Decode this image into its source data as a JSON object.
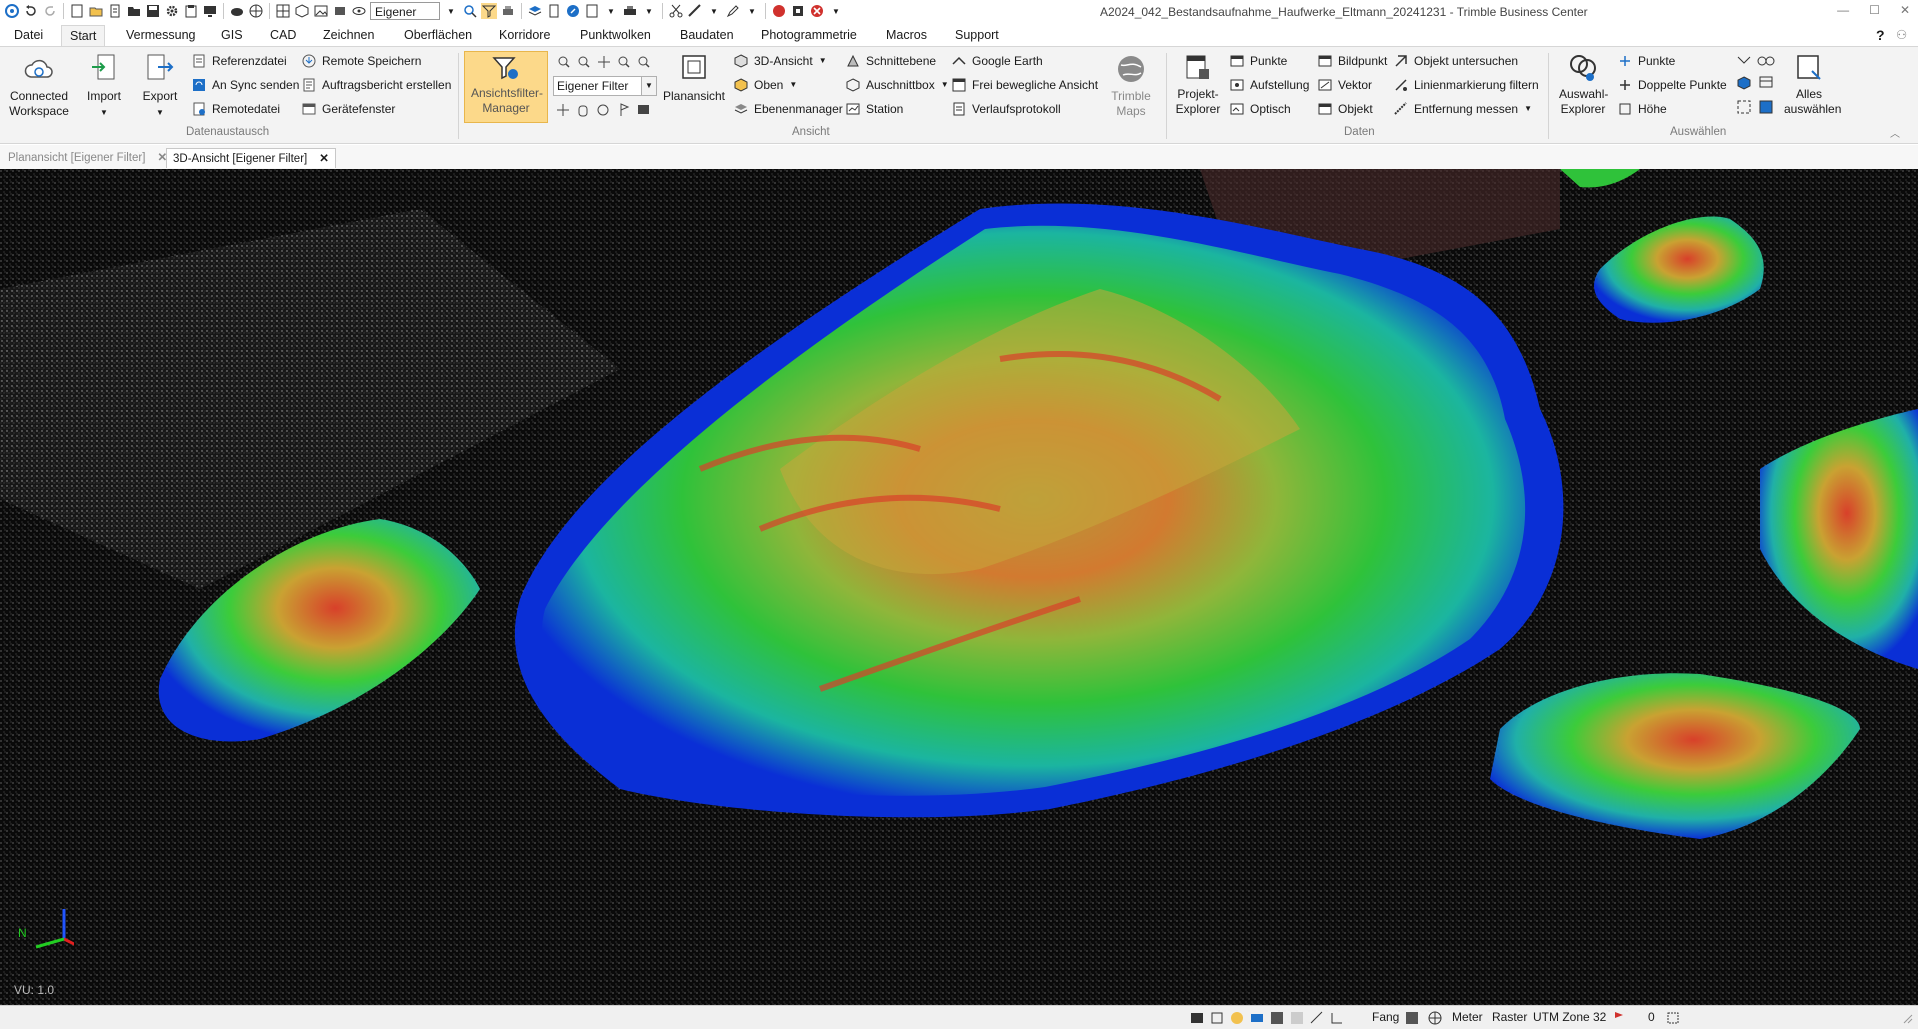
{
  "window": {
    "title": "A2024_042_Bestandsaufnahme_Haufwerke_Eltmann_20241231 - Trimble Business Center",
    "qat_filter": "Eigener Fi...",
    "help": "?"
  },
  "menu": {
    "tabs": [
      "Datei",
      "Start",
      "Vermessung",
      "GIS",
      "CAD",
      "Zeichnen",
      "Oberflächen",
      "Korridore",
      "Punktwolken",
      "Baudaten",
      "Photogrammetrie",
      "Macros",
      "Support"
    ],
    "active": "Start"
  },
  "ribbon": {
    "datenaustausch": {
      "label": "Datenaustausch",
      "connected_workspace": "Connected Workspace",
      "import": "Import",
      "export": "Export",
      "referenzdatei": "Referenzdatei",
      "an_sync_senden": "An Sync senden",
      "remotedatei": "Remotedatei",
      "remote_speichern": "Remote Speichern",
      "auftragsbericht": "Auftragsbericht erstellen",
      "geraetefenster": "Gerätefenster"
    },
    "ansicht": {
      "label": "Ansicht",
      "filter_manager": "Ansichtsfilter-Manager",
      "filter_value": "Eigener Filter",
      "planansicht": "Planansicht",
      "ansicht_3d": "3D-Ansicht",
      "oben": "Oben",
      "ebenenmanager": "Ebenenmanager",
      "schnittebene": "Schnittebene",
      "auschnittbox": "Auschnittbox",
      "station": "Station",
      "google_earth": "Google Earth",
      "frei_bewegliche": "Frei bewegliche Ansicht",
      "verlaufsprotokoll": "Verlaufsprotokoll",
      "trimble_maps": "Trimble Maps"
    },
    "daten": {
      "label": "Daten",
      "projekt_explorer": "Projekt-Explorer",
      "punkte": "Punkte",
      "aufstellung": "Aufstellung",
      "optisch": "Optisch",
      "bildpunkt": "Bildpunkt",
      "vektor": "Vektor",
      "objekt": "Objekt",
      "objekt_untersuchen": "Objekt untersuchen",
      "linienmarkierung": "Linienmarkierung filtern",
      "entfernung": "Entfernung messen"
    },
    "auswaehlen": {
      "label": "Auswählen",
      "auswahl_explorer": "Auswahl-Explorer",
      "punkte": "Punkte",
      "doppelte_punkte": "Doppelte Punkte",
      "hoehe": "Höhe",
      "alles_auswaehlen": "Alles auswählen"
    }
  },
  "doc_tabs": [
    {
      "label": "Planansicht  [Eigener Filter]",
      "active": false
    },
    {
      "label": "3D-Ansicht [Eigener Filter]",
      "active": true
    }
  ],
  "viewport": {
    "version": "VU: 1.0",
    "triad_north": "N"
  },
  "statusbar": {
    "fang": "Fang",
    "units": "Meter",
    "raster": "Raster",
    "zone": "UTM Zone 32",
    "count": "0"
  },
  "colors": {
    "ribbon_bg": "#f3f3f3",
    "highlight": "#fcd98a",
    "surface_low": "#0a2fd6",
    "surface_mid": "#2fc23a",
    "surface_high": "#d8402a"
  }
}
